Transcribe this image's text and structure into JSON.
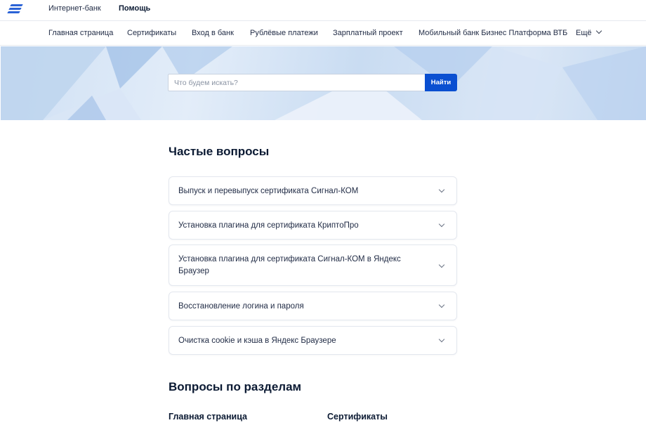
{
  "header": {
    "logo_icon": "vtb-logo-icon",
    "links": [
      "Интернет-банк",
      "Помощь"
    ],
    "active": "Помощь"
  },
  "nav": {
    "items": [
      "Главная страница",
      "Сертификаты",
      "Вход в банк",
      "Рублёвые платежи",
      "Зарплатный проект",
      "Мобильный банк Бизнес Платформа ВТБ"
    ],
    "more_label": "Ещё",
    "more_icon": "chevron-down-icon"
  },
  "search": {
    "placeholder": "Что будем искать?",
    "button_label": "Найти",
    "accent_color": "#0a4fd1"
  },
  "faq": {
    "title": "Частые вопросы",
    "items": [
      "Выпуск и перевыпуск сертификата Сигнал-КОМ",
      "Установка плагина для сертификата КриптоПро",
      "Установка плагина для сертификата Сигнал-КОМ в Яндекс Браузер",
      "Восстановление логина и пароля",
      "Очистка cookie и кэша в Яндекс Браузере"
    ]
  },
  "sections": {
    "title": "Вопросы по разделам",
    "items": [
      "Главная страница",
      "Сертификаты"
    ]
  }
}
